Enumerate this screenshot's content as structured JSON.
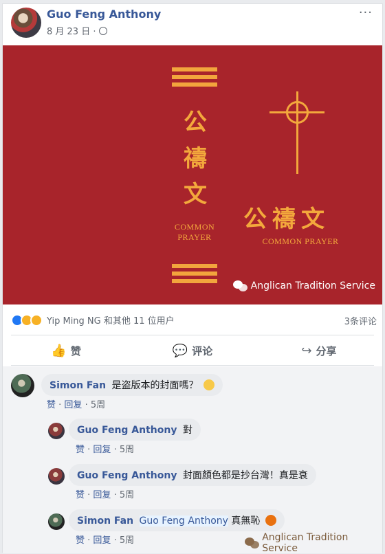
{
  "post": {
    "author": "Guo Feng Anthony",
    "date": "8 月 23 日",
    "separator": "·",
    "privacy_icon": "globe-icon",
    "more_label": "···"
  },
  "cover": {
    "title_vertical": [
      "公",
      "禱",
      "文"
    ],
    "sub_line1": "COMMON",
    "sub_line2": "PRAYER",
    "title_horizontal": "公禱文",
    "sub_horizontal": "COMMON PRAYER",
    "watermark": "Anglican Tradition Service",
    "colors": {
      "background": "#a8242b",
      "accent": "#f3a83c"
    }
  },
  "reactions": {
    "icons": [
      "like-icon",
      "wow-icon",
      "sad-icon"
    ],
    "summary": "Yip Ming NG 和其他 11 位用户",
    "comment_count": "3条评论"
  },
  "actions": [
    {
      "icon": "👍",
      "label": "赞"
    },
    {
      "icon": "💬",
      "label": "评论"
    },
    {
      "icon": "↪",
      "label": "分享"
    }
  ],
  "comments": [
    {
      "author": "Simon Fan",
      "text": "是盗版本的封面嗎？",
      "emoji": "confused-emoji",
      "like": "赞",
      "reply": "回复",
      "time": "5周"
    },
    {
      "author": "Guo Feng Anthony",
      "text": "對",
      "like": "赞",
      "reply": "回复",
      "time": "5周"
    },
    {
      "author": "Guo Feng Anthony",
      "text": "封面顏色都是抄台灣！真是衰",
      "like": "赞",
      "reply": "回复",
      "time": "5周"
    },
    {
      "author": "Simon Fan",
      "mention": "Guo Feng Anthony",
      "text": "真無恥",
      "emoji": "angry-emoji",
      "like": "赞",
      "reply": "回复",
      "time": "5周"
    }
  ],
  "footer_watermark": "Anglican Tradition Service"
}
